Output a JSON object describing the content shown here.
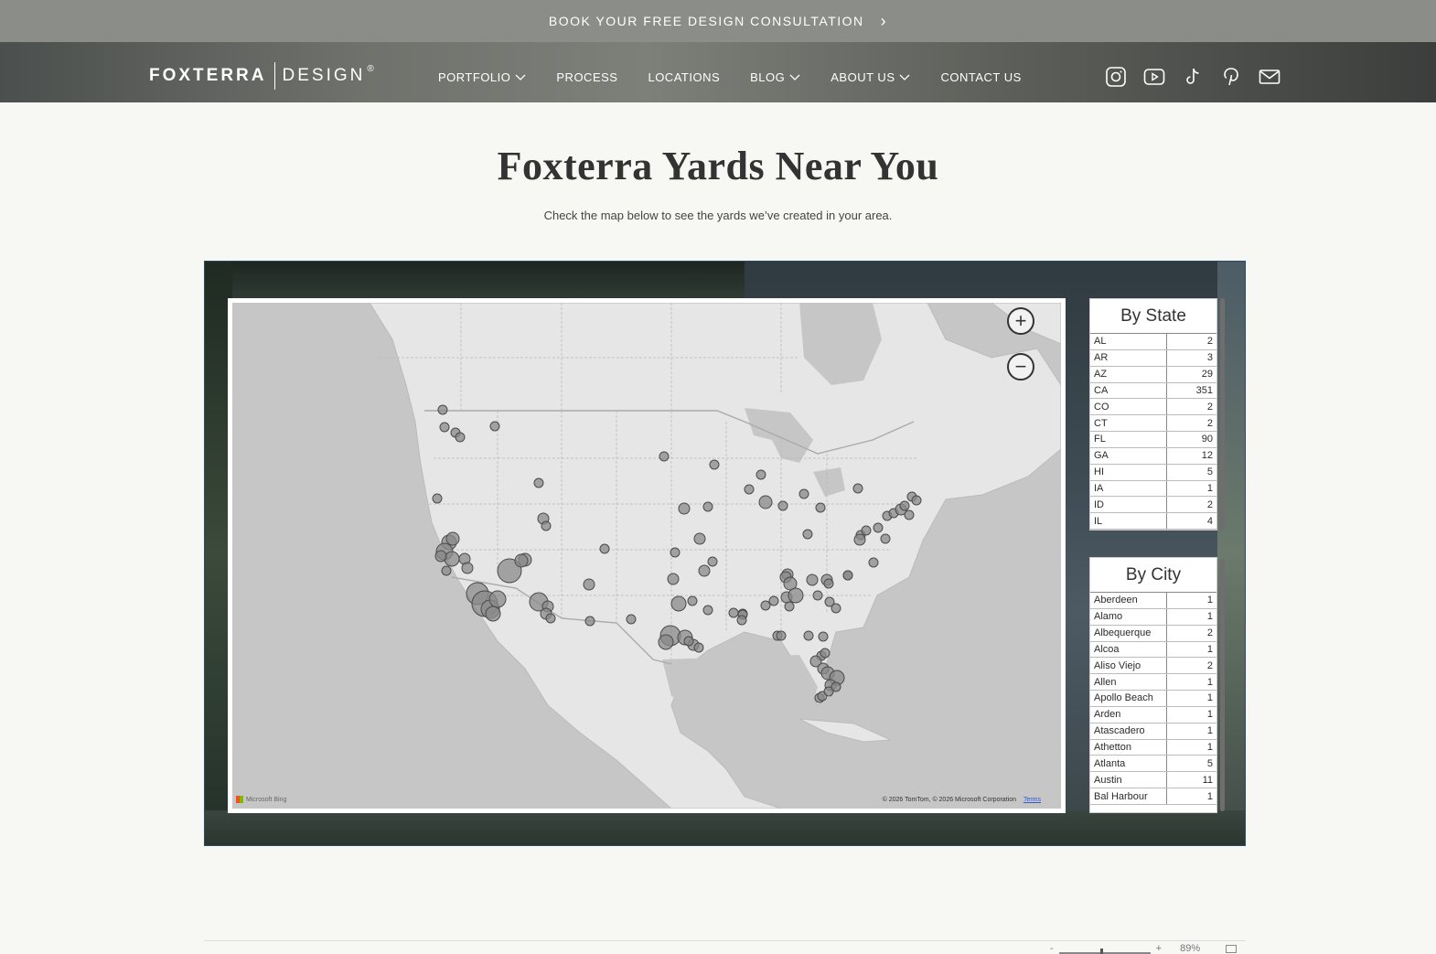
{
  "promo": {
    "text": "BOOK YOUR FREE DESIGN CONSULTATION",
    "chevron": "›"
  },
  "logo": {
    "bold": "FOXTERRA",
    "light": "DESIGN",
    "reg": "®"
  },
  "nav": [
    {
      "label": "PORTFOLIO",
      "dropdown": true
    },
    {
      "label": "PROCESS",
      "dropdown": false
    },
    {
      "label": "LOCATIONS",
      "dropdown": false
    },
    {
      "label": "BLOG",
      "dropdown": true
    },
    {
      "label": "ABOUT US",
      "dropdown": true
    },
    {
      "label": "CONTACT US",
      "dropdown": false
    }
  ],
  "socials": [
    "instagram-icon",
    "youtube-icon",
    "tiktok-icon",
    "pinterest-icon",
    "mail-icon"
  ],
  "headline": "Foxterra Yards Near You",
  "subline": "Check the map below to see the yards we’ve created in your area.",
  "map": {
    "zoom_in": "+",
    "zoom_out": "−",
    "bing_label": "Microsoft Bing",
    "copyright": "© 2026 TomTom, © 2026 Microsoft Corporation",
    "terms": "Terms"
  },
  "by_state": {
    "title": "By State",
    "rows": [
      [
        "AL",
        "2"
      ],
      [
        "AR",
        "3"
      ],
      [
        "AZ",
        "29"
      ],
      [
        "CA",
        "351"
      ],
      [
        "CO",
        "2"
      ],
      [
        "CT",
        "2"
      ],
      [
        "FL",
        "90"
      ],
      [
        "GA",
        "12"
      ],
      [
        "HI",
        "5"
      ],
      [
        "IA",
        "1"
      ],
      [
        "ID",
        "2"
      ],
      [
        "IL",
        "4"
      ]
    ]
  },
  "by_city": {
    "title": "By City",
    "rows": [
      [
        "Aberdeen",
        "1"
      ],
      [
        "Alamo",
        "1"
      ],
      [
        "Albequerque",
        "2"
      ],
      [
        "Alcoa",
        "1"
      ],
      [
        "Aliso Viejo",
        "2"
      ],
      [
        "Allen",
        "1"
      ],
      [
        "Apollo Beach",
        "1"
      ],
      [
        "Arden",
        "1"
      ],
      [
        "Atascadero",
        "1"
      ],
      [
        "Athetton",
        "1"
      ],
      [
        "Atlanta",
        "5"
      ],
      [
        "Austin",
        "11"
      ],
      [
        "Bal Harbour",
        "1"
      ]
    ]
  },
  "footer_zoom": {
    "minus": "-",
    "plus": "+",
    "percent": "89%"
  },
  "colors": {
    "promo_bg": "#8b8e88",
    "map_bg": "#c6c6c6",
    "marker": "#8a8a8a"
  }
}
